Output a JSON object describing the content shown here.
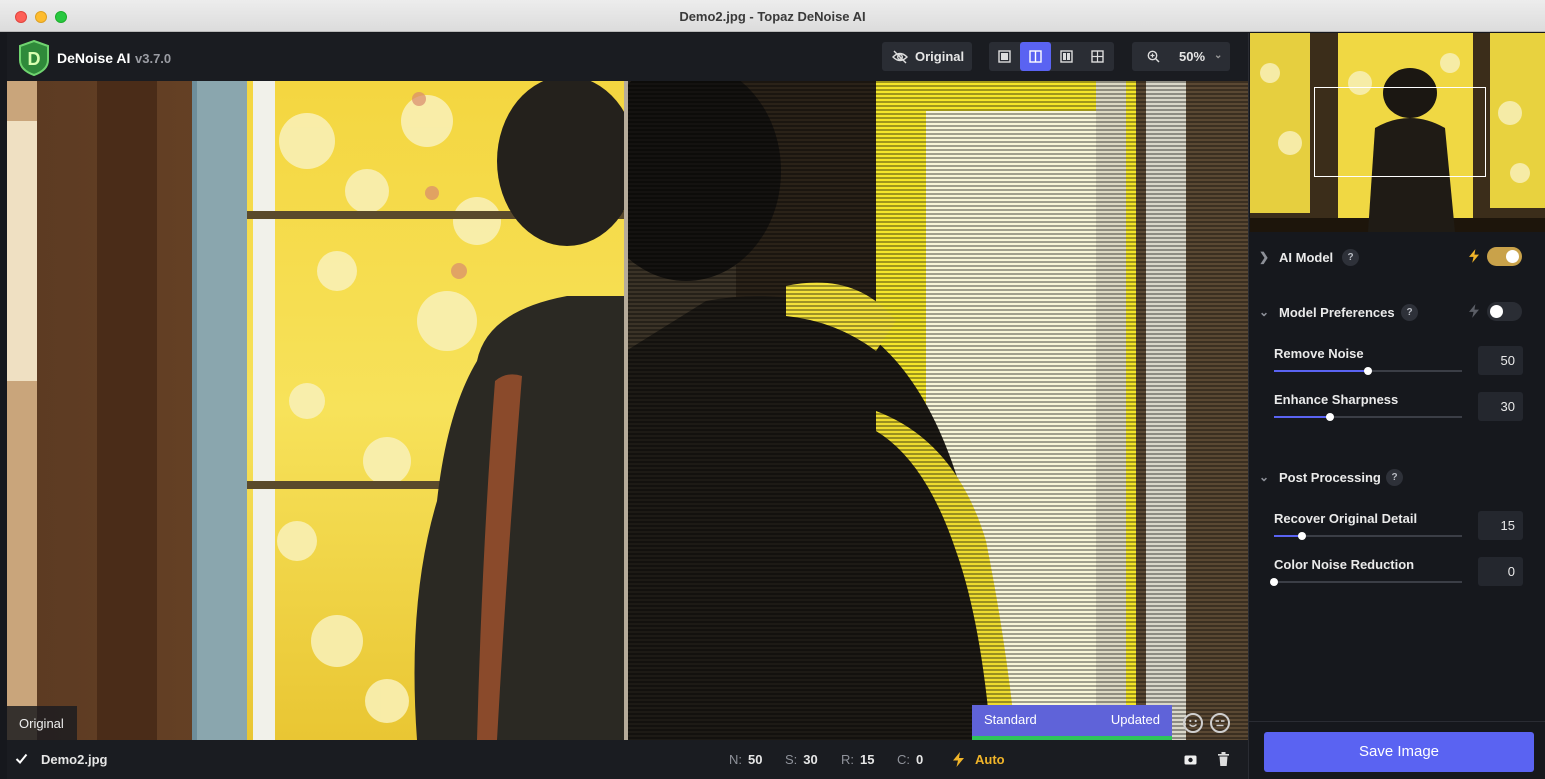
{
  "window": {
    "title": "Demo2.jpg - Topaz DeNoise AI"
  },
  "app": {
    "name": "DeNoise AI",
    "version": "v3.7.0",
    "logo_letter": "D"
  },
  "toolbar": {
    "original_label": "Original",
    "view_modes": [
      "single",
      "split",
      "side-by-side",
      "comparison"
    ],
    "active_view_mode": "split",
    "zoom_value": "50%"
  },
  "viewport": {
    "original_label": "Original",
    "model_label": "Standard",
    "model_status": "Updated"
  },
  "statusbar": {
    "filename": "Demo2.jpg",
    "stats": [
      {
        "key": "N:",
        "value": "50"
      },
      {
        "key": "S:",
        "value": "30"
      },
      {
        "key": "R:",
        "value": "15"
      },
      {
        "key": "C:",
        "value": "0"
      }
    ],
    "auto_label": "Auto"
  },
  "panel": {
    "ai_model": {
      "title": "AI Model",
      "help": "?",
      "toggle_on": true,
      "accent": "#c9a24a"
    },
    "model_preferences": {
      "title": "Model Preferences",
      "help": "?",
      "toggle_on": false,
      "sliders": [
        {
          "label": "Remove Noise",
          "value": "50",
          "fraction": 0.5
        },
        {
          "label": "Enhance Sharpness",
          "value": "30",
          "fraction": 0.3
        }
      ]
    },
    "post_processing": {
      "title": "Post Processing",
      "help": "?",
      "sliders": [
        {
          "label": "Recover Original Detail",
          "value": "15",
          "fraction": 0.15
        },
        {
          "label": "Color Noise Reduction",
          "value": "0",
          "fraction": 0.0
        }
      ]
    },
    "save_label": "Save Image"
  },
  "colors": {
    "accent": "#5a63f2",
    "auto": "#f0b429",
    "progress": "#2ec45a"
  }
}
